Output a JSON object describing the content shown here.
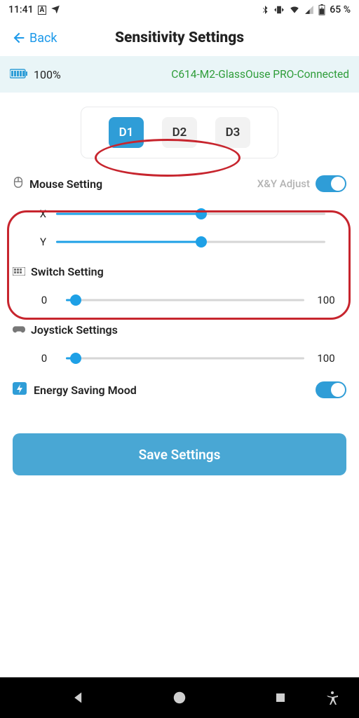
{
  "status": {
    "time": "11:41",
    "battery_pct": "65 %"
  },
  "header": {
    "back_label": "Back",
    "title": "Sensitivity Settings"
  },
  "banner": {
    "battery": "100%",
    "device": "C614-M2-GlassOuse PRO-Connected"
  },
  "profiles": {
    "items": [
      {
        "label": "D1",
        "selected": true
      },
      {
        "label": "D2",
        "selected": false
      },
      {
        "label": "D3",
        "selected": false
      }
    ]
  },
  "mouse_setting": {
    "title": "Mouse Setting",
    "xy_adjust_label": "X&Y Adjust",
    "xy_adjust_on": true,
    "x_label": "X",
    "y_label": "Y",
    "x_value": 54,
    "y_value": 54
  },
  "switch_setting": {
    "title": "Switch Setting",
    "min": "0",
    "max": "100",
    "value": 4
  },
  "joystick_setting": {
    "title": "Joystick Settings",
    "min": "0",
    "max": "100",
    "value": 4
  },
  "energy_saving": {
    "title": "Energy Saving Mood",
    "on": true
  },
  "save_label": "Save Settings"
}
